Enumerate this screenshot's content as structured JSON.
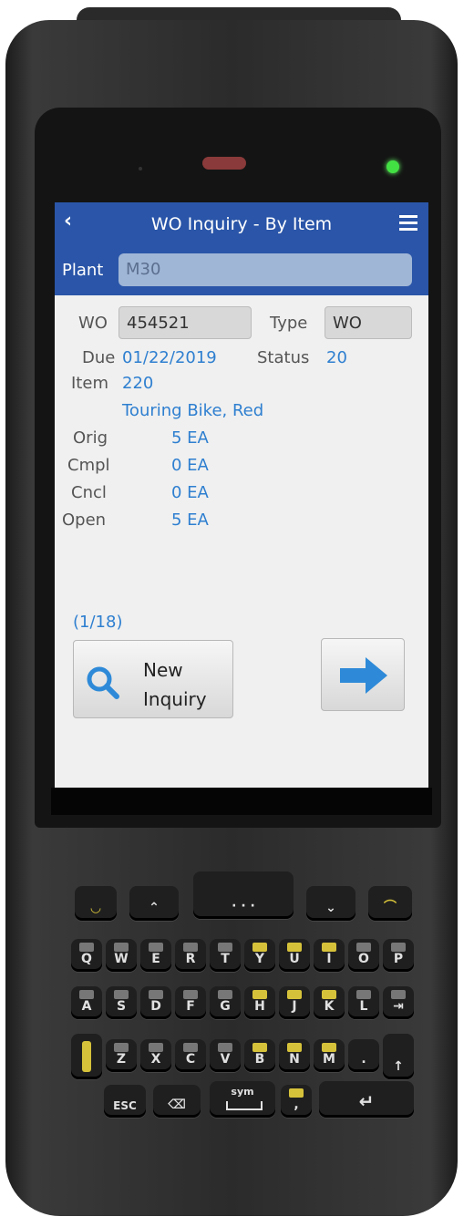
{
  "header": {
    "back_icon": "chevron-left-icon",
    "title": "WO Inquiry - By Item",
    "menu_icon": "hamburger-menu-icon"
  },
  "plant": {
    "label": "Plant",
    "value": "M30"
  },
  "wo": {
    "label": "WO",
    "value": "454521"
  },
  "type": {
    "label": "Type",
    "value": "WO"
  },
  "due": {
    "label": "Due",
    "value": "01/22/2019"
  },
  "status": {
    "label": "Status",
    "value": "20"
  },
  "item": {
    "label": "Item",
    "value": "220",
    "description": "Touring Bike, Red"
  },
  "quantities": {
    "orig_label": "Orig",
    "orig_value": "5 EA",
    "cmpl_label": "Cmpl",
    "cmpl_value": "0 EA",
    "cncl_label": "Cncl",
    "cncl_value": "0 EA",
    "open_label": "Open",
    "open_value": "5 EA"
  },
  "pager": {
    "text": "(1/18)"
  },
  "actions": {
    "new_inquiry_line1": "New",
    "new_inquiry_line2": "Inquiry",
    "search_icon": "search-icon",
    "next_icon": "arrow-right-icon"
  },
  "colors": {
    "header_bg": "#2a55a8",
    "value_text": "#2e7fd0",
    "arrow": "#2e8ad8"
  },
  "keypad": {
    "row1": [
      "",
      "",
      "· · ·",
      "",
      ""
    ],
    "row2": [
      "Q",
      "W",
      "E",
      "R",
      "T",
      "Y",
      "U",
      "I",
      "O",
      "P"
    ],
    "row3": [
      "A",
      "S",
      "D",
      "F",
      "G",
      "H",
      "J",
      "K",
      "L",
      "⇥"
    ],
    "row4": [
      "",
      "Z",
      "X",
      "C",
      "V",
      "B",
      "N",
      "M",
      ".",
      "↑"
    ],
    "row5": [
      "ESC",
      "⌫",
      "sym",
      ",",
      "↵"
    ]
  }
}
